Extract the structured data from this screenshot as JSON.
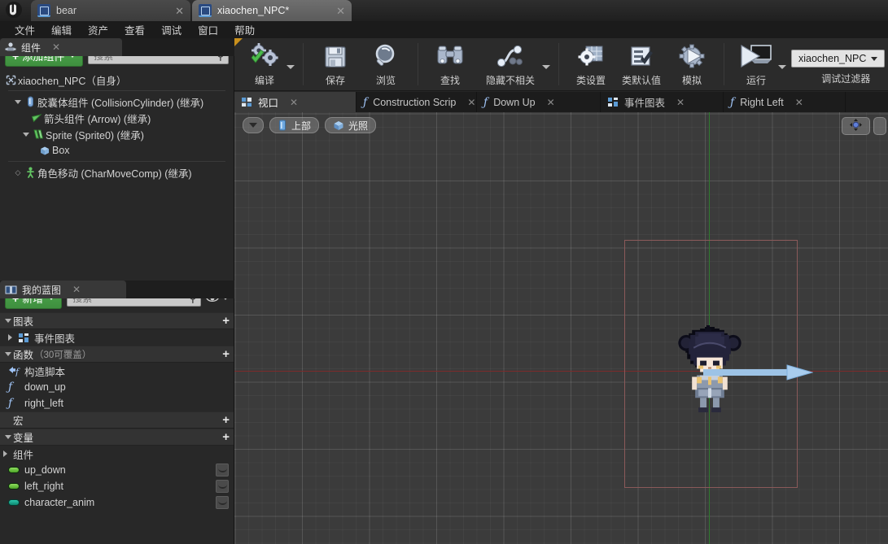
{
  "window": {
    "logo_icon": "unreal-engine-logo",
    "tabs": [
      {
        "label": "bear",
        "icon": "blueprint-icon",
        "active": false,
        "close_icon": "close-icon"
      },
      {
        "label": "xiaochen_NPC*",
        "icon": "blueprint-icon",
        "active": true,
        "close_icon": "close-icon"
      }
    ]
  },
  "menu": {
    "items": [
      {
        "label": "文件"
      },
      {
        "label": "编辑"
      },
      {
        "label": "资产"
      },
      {
        "label": "查看"
      },
      {
        "label": "调试"
      },
      {
        "label": "窗口"
      },
      {
        "label": "帮助"
      }
    ]
  },
  "toolbar": {
    "compile": {
      "label": "编译",
      "icon": "compile-gears-check-icon",
      "has_caret": true
    },
    "save": {
      "label": "保存",
      "icon": "floppy-disk-icon"
    },
    "browse": {
      "label": "浏览",
      "icon": "magnifier-icon"
    },
    "find": {
      "label": "查找",
      "icon": "binoculars-icon"
    },
    "hide_unrelated": {
      "label": "隐藏不相关",
      "icon": "node-graph-icon",
      "has_caret": true
    },
    "class_settings": {
      "label": "类设置",
      "icon": "gear-window-icon"
    },
    "class_defaults": {
      "label": "类默认值",
      "icon": "list-check-icon"
    },
    "simulate": {
      "label": "模拟",
      "icon": "gear-play-icon"
    },
    "play": {
      "label": "运行",
      "icon": "play-screen-icon",
      "has_caret": true
    },
    "debug_filter": {
      "value": "xiaochen_NPC",
      "caption": "调试过滤器",
      "search_icon": "magnifier-icon",
      "caret_icon": "chevron-down-icon"
    }
  },
  "components_panel": {
    "tab": {
      "label": "组件",
      "icon": "components-icon",
      "close_icon": "close-icon"
    },
    "add_button": {
      "label": "添加组件",
      "plus": "+",
      "caret_icon": "chevron-down-icon"
    },
    "search": {
      "placeholder": "搜索",
      "icon": "magnifier-icon"
    },
    "root": {
      "label": "xiaochen_NPC（自身）",
      "icon": "blueprint-icon"
    },
    "tree": [
      {
        "label": "胶囊体组件 (CollisionCylinder) (继承)",
        "icon": "capsule-icon",
        "indent": 1,
        "expander": "down"
      },
      {
        "label": "箭头组件 (Arrow) (继承)",
        "icon": "arrow-component-icon",
        "indent": 2,
        "expander": "none"
      },
      {
        "label": "Sprite (Sprite0) (继承)",
        "icon": "sprite-icon",
        "indent": 2,
        "expander": "down"
      },
      {
        "label": "Box",
        "icon": "box-icon",
        "indent": 3,
        "expander": "none"
      },
      {
        "label": "角色移动 (CharMoveComp) (继承)",
        "icon": "character-movement-icon",
        "indent": 1,
        "expander": "none"
      }
    ]
  },
  "blueprint_panel": {
    "tab": {
      "label": "我的蓝图",
      "icon": "book-icon",
      "close_icon": "close-icon"
    },
    "add_button": {
      "label": "新增",
      "plus": "+",
      "caret_icon": "chevron-down-icon"
    },
    "search": {
      "placeholder": "搜索",
      "icon": "magnifier-icon"
    },
    "eye_icon": "eye-icon",
    "eye_caret_icon": "chevron-down-icon",
    "sections": [
      {
        "title": "图表",
        "subtitle": "",
        "plus": "+",
        "expander": "down",
        "items": [
          {
            "label": "事件图表",
            "icon": "event-graph-icon",
            "expander": "right",
            "visibility_toggle": false
          }
        ]
      },
      {
        "title": "函数",
        "subtitle": "（30可覆盖）",
        "plus": "+",
        "expander": "down",
        "items": [
          {
            "label": "构造脚本",
            "icon": "construction-script-icon",
            "expander": "none",
            "visibility_toggle": false
          },
          {
            "label": "down_up",
            "icon": "function-icon",
            "expander": "none",
            "visibility_toggle": false
          },
          {
            "label": "right_left",
            "icon": "function-icon",
            "expander": "none",
            "visibility_toggle": false
          }
        ]
      },
      {
        "title": "宏",
        "subtitle": "",
        "plus": "+",
        "expander": "none",
        "items": []
      },
      {
        "title": "变量",
        "subtitle": "",
        "plus": "+",
        "expander": "down",
        "items": [
          {
            "label": "组件",
            "icon": "none",
            "expander": "right",
            "visibility_toggle": false
          },
          {
            "label": "up_down",
            "icon": "variable-pill-icon",
            "color": "#6cc24a",
            "expander": "none",
            "visibility_toggle": true
          },
          {
            "label": "left_right",
            "icon": "variable-pill-icon",
            "color": "#6cc24a",
            "expander": "none",
            "visibility_toggle": true
          },
          {
            "label": "character_anim",
            "icon": "variable-pill-icon",
            "color": "#14a88f",
            "expander": "none",
            "visibility_toggle": true
          }
        ]
      }
    ]
  },
  "document_tabs": [
    {
      "label": "视口",
      "icon": "viewport-icon",
      "active": true,
      "close_icon": "close-icon"
    },
    {
      "label": "Construction Scrip",
      "icon": "function-icon",
      "active": false,
      "close_icon": "close-icon"
    },
    {
      "label": "Down Up",
      "icon": "function-icon",
      "active": false,
      "close_icon": "close-icon"
    },
    {
      "label": "事件图表",
      "icon": "event-graph-icon",
      "active": false,
      "close_icon": "close-icon"
    },
    {
      "label": "Right Left",
      "icon": "function-icon",
      "active": false,
      "close_icon": "close-icon"
    }
  ],
  "viewport": {
    "caret_icon": "chevron-down-icon",
    "view_mode": {
      "label": "上部",
      "icon": "camera-top-icon"
    },
    "lighting": {
      "label": "光照",
      "icon": "lit-cube-icon"
    },
    "transform_widget_icon": "move-widget-icon",
    "colors": {
      "background": "#3b3b3b",
      "x_axis": "#7d2b2b",
      "y_axis": "#2f7a2f",
      "selection_box": "#8b5a5a",
      "gizmo_arrow": "#9dc3e6"
    }
  }
}
